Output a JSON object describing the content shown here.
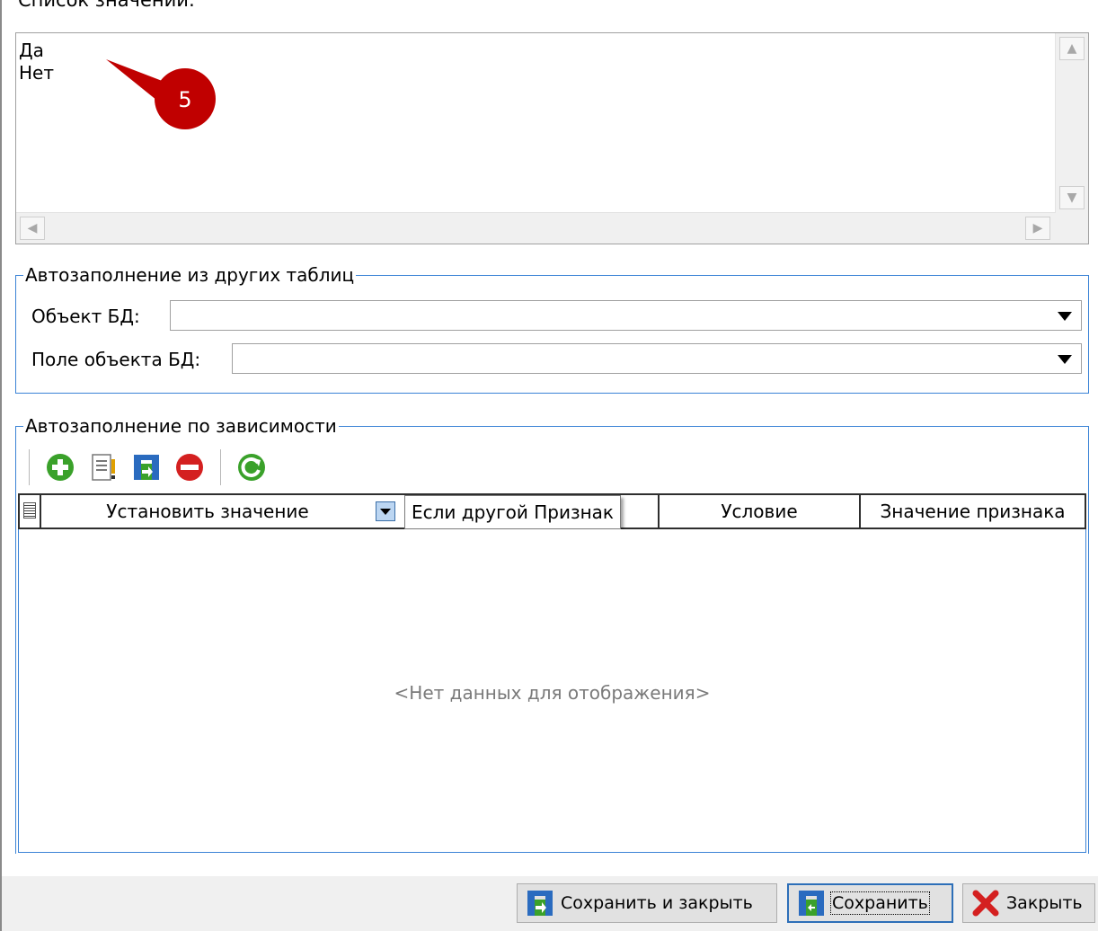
{
  "values_list": {
    "label": "Список значений:",
    "items": [
      "Да",
      "Нет"
    ],
    "annotation_number": "5"
  },
  "autofill_tables": {
    "title": "Автозаполнение из других таблиц",
    "db_object_label": "Объект БД:",
    "db_object_value": "",
    "db_field_label": "Поле объекта БД:",
    "db_field_value": ""
  },
  "autofill_dependency": {
    "title": "Автозаполнение по зависимости",
    "toolbar": [
      "add-icon",
      "edit-icon",
      "save-icon",
      "delete-icon",
      "refresh-icon"
    ],
    "columns": [
      "Установить значение",
      "Условие",
      "Значение признака"
    ],
    "tooltip": "Если другой Признак",
    "empty_text": "<Нет данных для отображения>"
  },
  "buttons": {
    "save_close": "Сохранить и закрыть",
    "save": "Сохранить",
    "close": "Закрыть"
  },
  "colors": {
    "accent": "#3b83d6",
    "marker": "#c00000",
    "add_green": "#3aa12a",
    "delete_red": "#d42020"
  }
}
